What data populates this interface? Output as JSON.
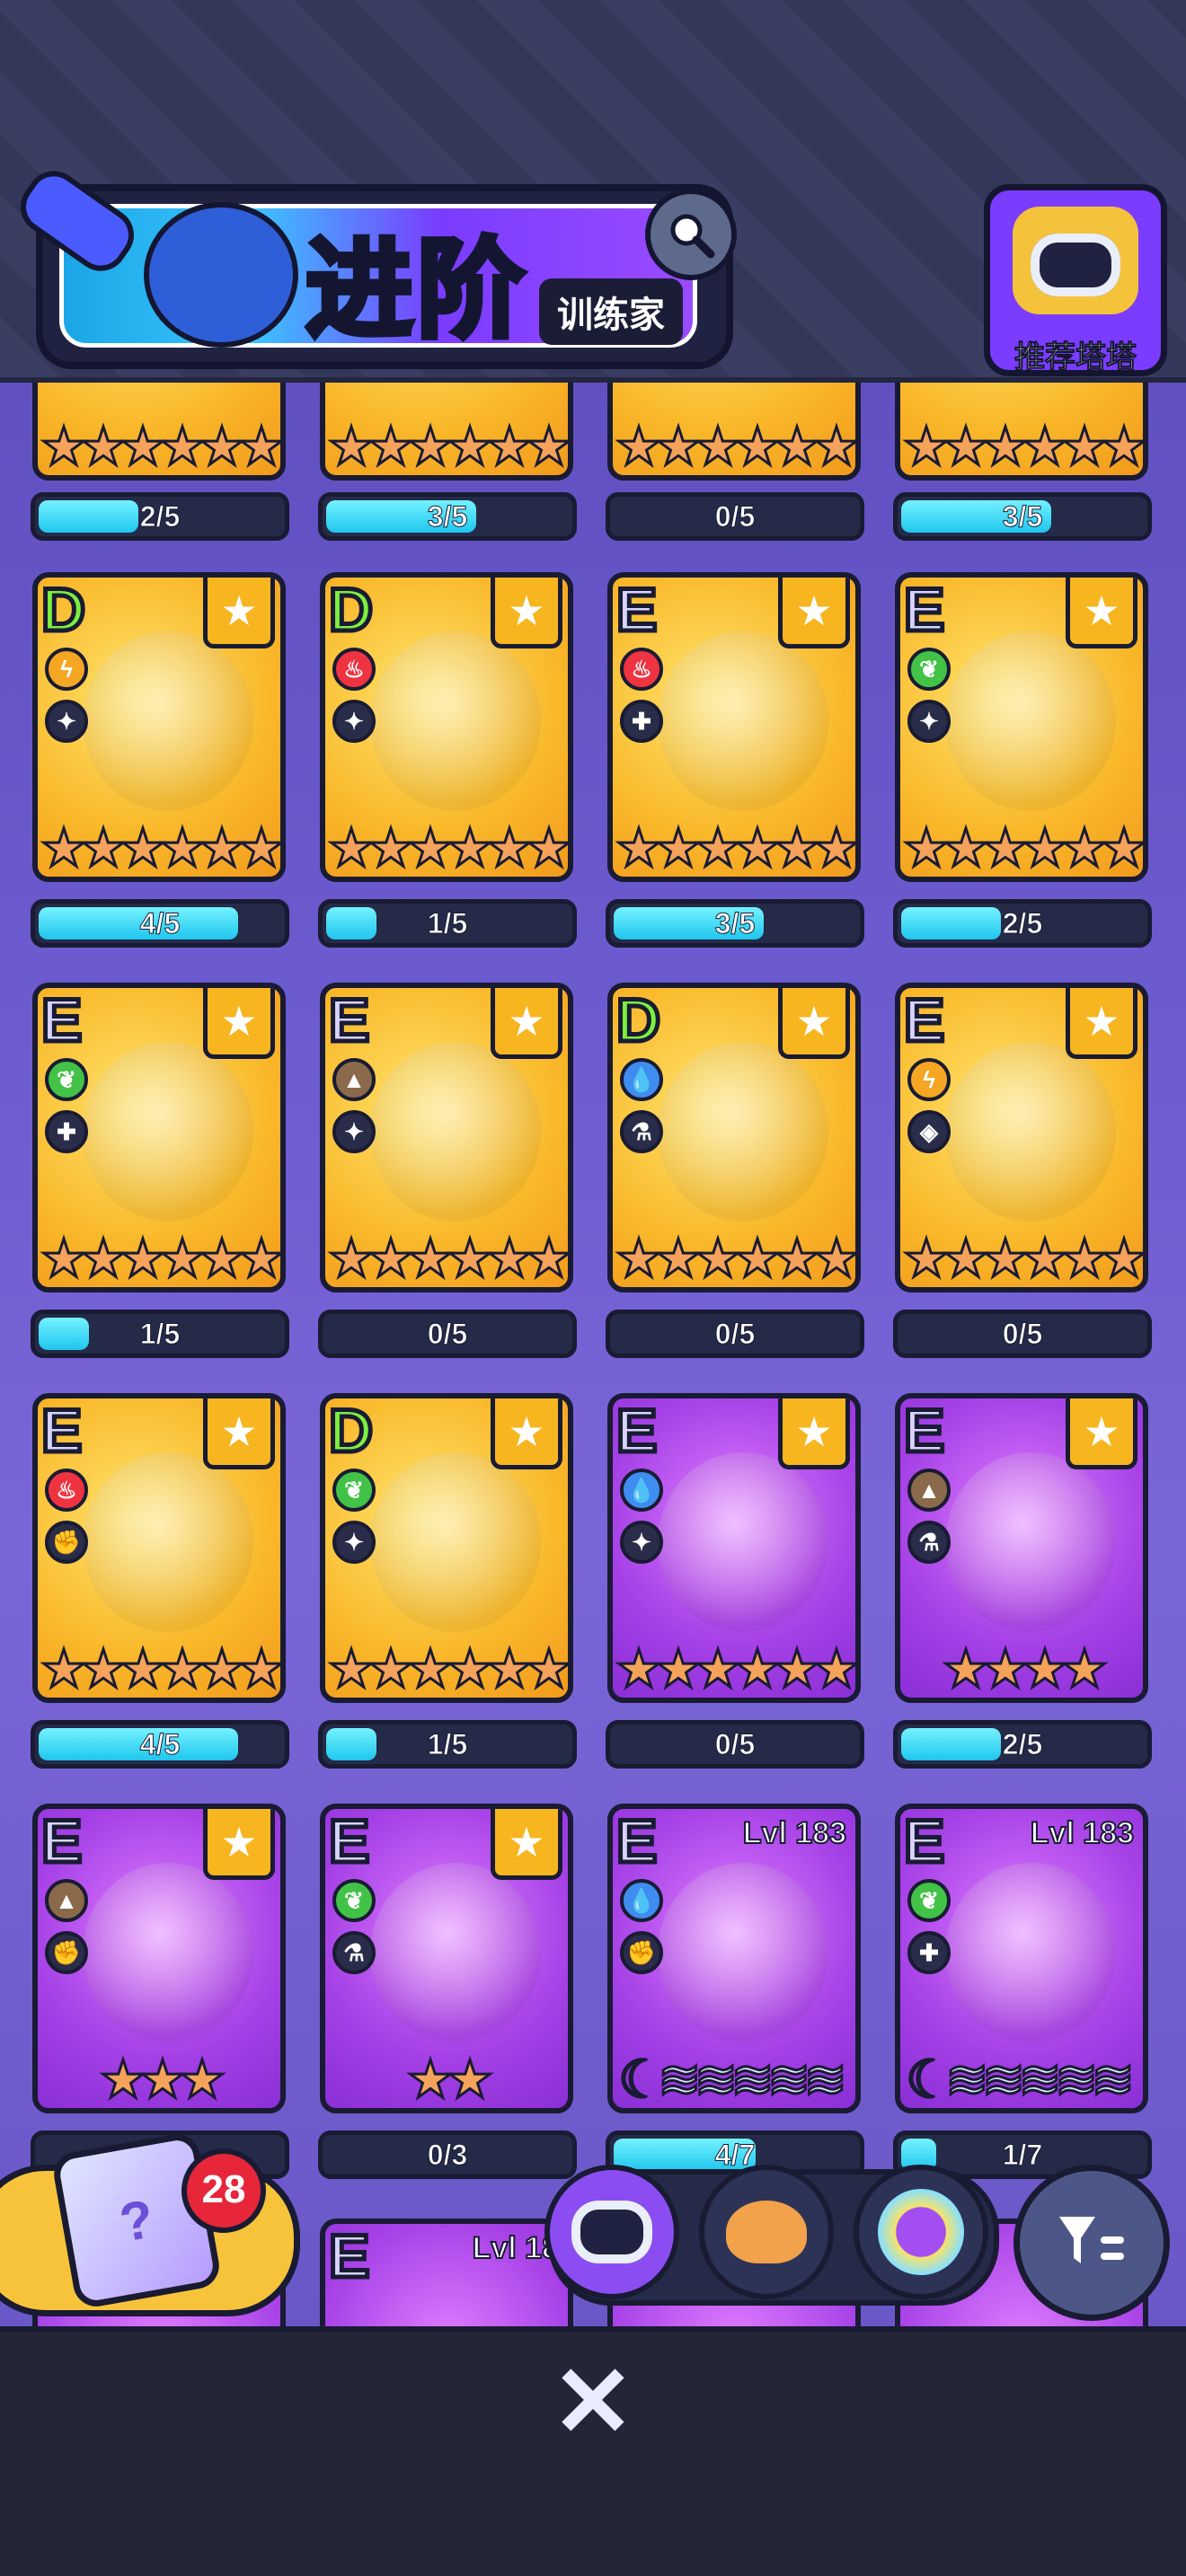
{
  "header": {
    "title": "进阶",
    "subtitle": "训练家",
    "recommend_label": "推荐塔塔"
  },
  "top_row_bars": [
    {
      "text": "2/5",
      "progress": 0.4
    },
    {
      "text": "3/5",
      "progress": 0.6
    },
    {
      "text": "0/5",
      "progress": 0.0
    },
    {
      "text": "3/5",
      "progress": 0.6
    }
  ],
  "cards": [
    {
      "grade": "D",
      "element": "thunder",
      "role_icon": "agility-icon",
      "bg": "gold",
      "stars": "★★★★★★",
      "progress_text": "4/5",
      "progress": 0.8
    },
    {
      "grade": "D",
      "element": "fire",
      "role_icon": "agility-icon",
      "bg": "gold",
      "stars": "★★★★★★",
      "progress_text": "1/5",
      "progress": 0.2
    },
    {
      "grade": "E",
      "element": "fire",
      "role_icon": "heal-icon",
      "bg": "gold",
      "stars": "★★★★★★",
      "progress_text": "3/5",
      "progress": 0.6
    },
    {
      "grade": "E",
      "element": "grass",
      "role_icon": "agility-icon",
      "bg": "gold",
      "stars": "★★★★★★",
      "progress_text": "2/5",
      "progress": 0.4
    },
    {
      "grade": "E",
      "element": "grass",
      "role_icon": "heal-icon",
      "bg": "gold",
      "stars": "★★★★★★",
      "progress_text": "1/5",
      "progress": 0.2
    },
    {
      "grade": "E",
      "element": "earth",
      "role_icon": "agility-icon",
      "bg": "gold",
      "stars": "★★★★★★",
      "progress_text": "0/5",
      "progress": 0.0
    },
    {
      "grade": "D",
      "element": "water",
      "role_icon": "potion-icon",
      "bg": "gold",
      "stars": "★★★★★★",
      "progress_text": "0/5",
      "progress": 0.0
    },
    {
      "grade": "E",
      "element": "thunder",
      "role_icon": "eye-icon",
      "bg": "gold",
      "stars": "★★★★★★",
      "progress_text": "0/5",
      "progress": 0.0
    },
    {
      "grade": "E",
      "element": "fire",
      "role_icon": "strength-icon",
      "bg": "gold",
      "stars": "★★★★★★",
      "progress_text": "4/5",
      "progress": 0.8
    },
    {
      "grade": "D",
      "element": "grass",
      "role_icon": "agility-icon",
      "bg": "gold",
      "stars": "★★★★★★",
      "progress_text": "1/5",
      "progress": 0.2
    },
    {
      "grade": "E",
      "element": "water",
      "role_icon": "agility-icon",
      "bg": "purple",
      "stars": "★★★★★★",
      "progress_text": "0/5",
      "progress": 0.0
    },
    {
      "grade": "E",
      "element": "earth",
      "role_icon": "potion-icon",
      "bg": "purple",
      "stars": "★★★★",
      "progress_text": "2/5",
      "progress": 0.4
    },
    {
      "grade": "E",
      "element": "earth",
      "role_icon": "strength-icon",
      "bg": "purple",
      "stars": "★★★",
      "progress_text": "",
      "progress": 0.0
    },
    {
      "grade": "E",
      "element": "grass",
      "role_icon": "potion-icon",
      "bg": "purple",
      "stars": "★★",
      "progress_text": "0/3",
      "progress": 0.0
    },
    {
      "grade": "E",
      "element": "water",
      "role_icon": "strength-icon",
      "bg": "purple",
      "stars": "☾≋≋≋≋≋",
      "level": "Lvl 183",
      "progress_text": "4/7",
      "progress": 0.57
    },
    {
      "grade": "E",
      "element": "grass",
      "role_icon": "heal-icon",
      "bg": "purple",
      "stars": "☾≋≋≋≋≋",
      "level": "Lvl 183",
      "progress_text": "1/7",
      "progress": 0.14
    }
  ],
  "partial_card": {
    "grade": "E",
    "level": "Lvl 18"
  },
  "mystery_box": {
    "count": "28"
  },
  "tabs": [
    {
      "name": "tata",
      "active": true
    },
    {
      "name": "pet",
      "active": false
    },
    {
      "name": "star-tata",
      "active": false
    }
  ],
  "colors": {
    "fire": "#ef3340",
    "thunder": "#f5a623",
    "grass": "#42c246",
    "water": "#3f8df0",
    "earth": "#8a6a4a"
  }
}
